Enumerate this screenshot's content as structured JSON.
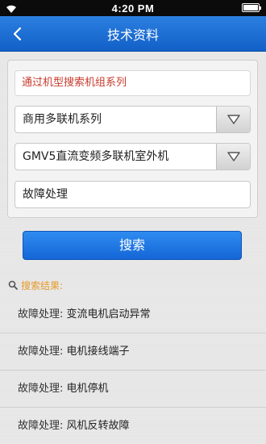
{
  "status_bar": {
    "time": "4:20 PM"
  },
  "nav": {
    "title": "技术资料"
  },
  "search": {
    "series_label": "通过机型搜索机组系列",
    "category_select": "商用多联机系列",
    "model_select": "GMV5直流变频多联机室外机",
    "keyword": "故障处理",
    "button_label": "搜索"
  },
  "results": {
    "header": "搜索结果:",
    "items": [
      {
        "prefix": "故障处理:",
        "text": "变流电机启动异常"
      },
      {
        "prefix": "故障处理:",
        "text": "电机接线端子"
      },
      {
        "prefix": "故障处理:",
        "text": "电机停机"
      },
      {
        "prefix": "故障处理:",
        "text": "风机反转故障"
      }
    ]
  },
  "colors": {
    "nav_blue": "#1f70d6",
    "accent_red": "#c63a2c",
    "results_orange": "#e59a2a"
  }
}
